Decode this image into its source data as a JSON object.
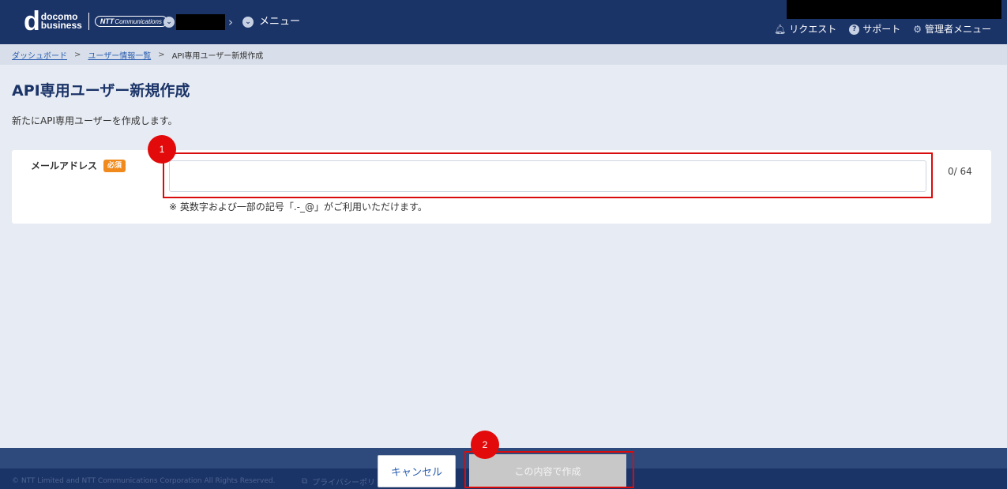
{
  "header": {
    "logo": {
      "mark": "d",
      "line1": "docomo",
      "line2": "business",
      "partner_bold": "NTT",
      "partner_text": "Communications"
    },
    "menu_label": "メニュー",
    "links": [
      {
        "label": "リクエスト",
        "icon": "bell-icon"
      },
      {
        "label": "サポート",
        "icon": "question-circle-icon"
      },
      {
        "label": "管理者メニュー",
        "icon": "gear-icon"
      }
    ]
  },
  "breadcrumb": {
    "items": [
      "ダッシュボード",
      "ユーザー情報一覧"
    ],
    "current": "API専用ユーザー新規作成",
    "separator": ">"
  },
  "page": {
    "title": "API専用ユーザー新規作成",
    "description": "新たにAPI専用ユーザーを作成します。"
  },
  "form": {
    "email_label": "メールアドレス",
    "required_badge": "必須",
    "email_value": "",
    "counter": "0/ 64",
    "hint": "※ 英数字および一部の記号「.-_@」がご利用いただけます。"
  },
  "annotations": {
    "step1": "1",
    "step2": "2"
  },
  "footer": {
    "copyright": "© NTT Limited and NTT Communications Corporation All Rights Reserved.",
    "privacy": "プライバシーポリ",
    "cancel_label": "キャンセル",
    "create_label": "この内容で作成"
  },
  "colors": {
    "header": "#1b3468",
    "accent": "#2a5db0",
    "required": "#f08a1c",
    "annotation": "#e20a0a"
  }
}
